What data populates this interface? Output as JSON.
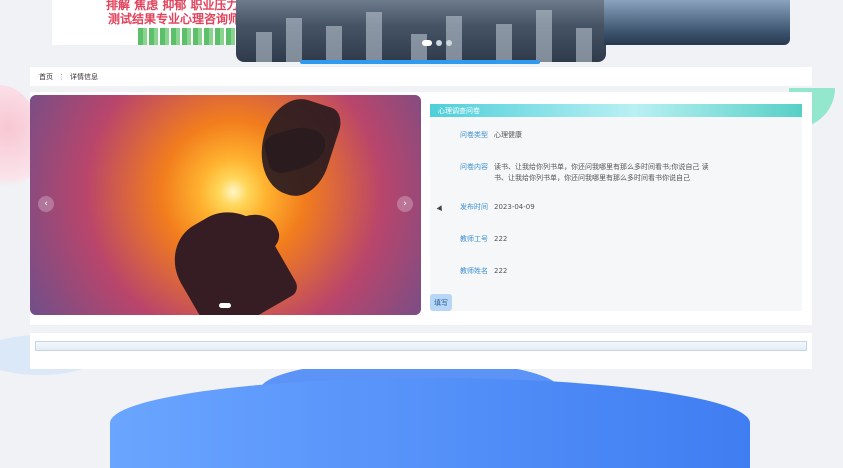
{
  "banner": {
    "line1": "排解 焦虑 抑郁 职业压力",
    "line2": "测试结果专业心理咨询师",
    "slides": 3,
    "active_slide": 0
  },
  "breadcrumb": {
    "home": "首页",
    "separator": "⋮",
    "current": "详情信息"
  },
  "detail": {
    "title": "心理调查问卷",
    "fields": [
      {
        "label": "问卷类型",
        "value": "心理健康"
      },
      {
        "label": "问卷内容",
        "value": "读书、让我给你列书单，你还问我哪里有那么多时间看书;你说自己 读书、让我给你列书单，你还问我哪里有那么多时间看书你说自己"
      },
      {
        "label": "发布时间",
        "value": "2023-04-09"
      },
      {
        "label": "教师工号",
        "value": "222"
      },
      {
        "label": "教师姓名",
        "value": "222"
      }
    ],
    "fill_button": "填写"
  },
  "carousel": {
    "prev_icon": "‹",
    "next_icon": "›"
  },
  "colors": {
    "accent": "#4fcfd9",
    "label": "#3a8fd1",
    "button": "#b8d6f5"
  }
}
